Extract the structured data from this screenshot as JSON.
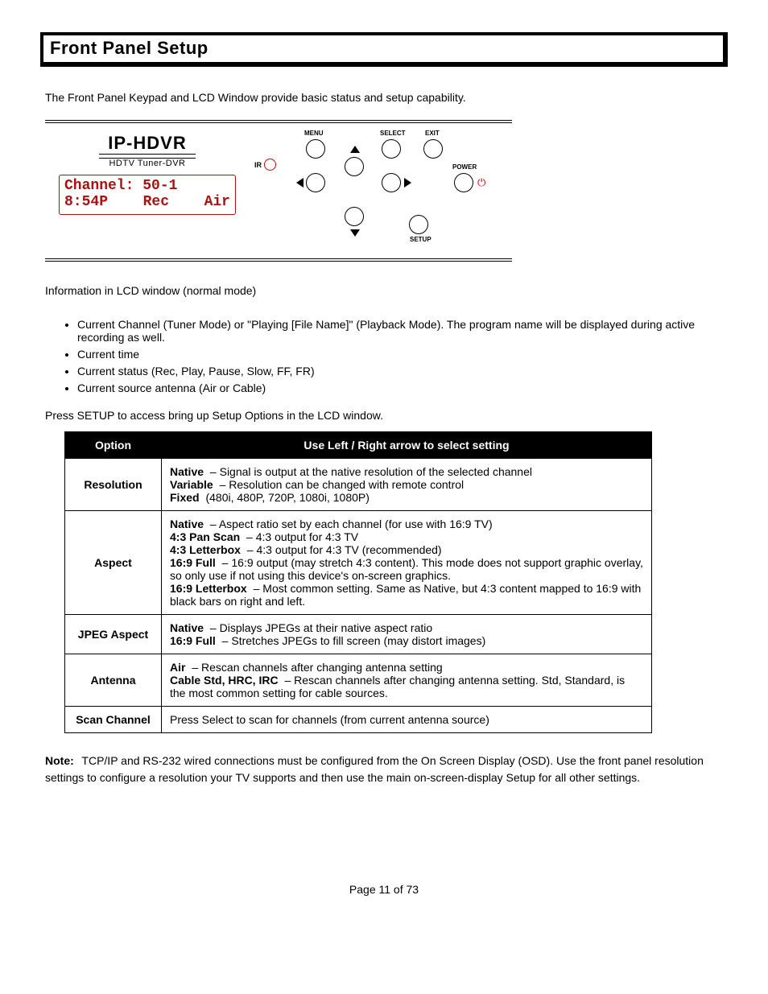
{
  "title": "Front Panel Setup",
  "intro": "The Front Panel Keypad and LCD Window provide basic status and setup capability.",
  "panel": {
    "brand": "IP-HDVR",
    "brandSub": "HDTV Tuner-DVR",
    "lcdLine1": "Channel: 50-1",
    "lcdTime": "8:54P",
    "lcdRec": "Rec",
    "lcdSrc": "Air",
    "irLabel": "IR",
    "labels": {
      "menu": "MENU",
      "select": "SELECT",
      "exit": "EXIT",
      "power": "POWER",
      "setup": "SETUP"
    }
  },
  "featuresLead": "Information in LCD window (normal mode)",
  "features": [
    "Current Channel (Tuner Mode) or \"Playing [File Name]\" (Playback Mode). The program name will be displayed during active recording as well.",
    "Current time",
    "Current status (Rec, Play, Pause, Slow, FF, FR)",
    "Current source antenna (Air or Cable)"
  ],
  "tableLead": "Press SETUP to access bring up Setup Options in the LCD window.",
  "table": {
    "headers": [
      "Option",
      "Use Left / Right arrow to select setting"
    ],
    "rows": [
      {
        "option": "Resolution",
        "settings": [
          [
            "Native",
            "Signal is output at the native resolution of the selected channel"
          ],
          [
            "Variable",
            "Resolution can be changed with remote control"
          ],
          [
            "Fixed",
            "(480i, 480P, 720P, 1080i, 1080P)"
          ]
        ]
      },
      {
        "option": "Aspect",
        "settings": [
          [
            "Native",
            "Aspect ratio set by each channel (for use with 16:9 TV)"
          ],
          [
            "4:3 Pan Scan",
            "4:3 output for 4:3 TV"
          ],
          [
            "4:3 Letterbox",
            "4:3 output for 4:3 TV (recommended)"
          ],
          [
            "16:9 Full",
            "16:9 output (may stretch 4:3 content). This mode does not support graphic overlay, so only use if not using this device's on-screen graphics."
          ],
          [
            "16:9 Letterbox",
            "Most common setting. Same as Native, but 4:3 content mapped to 16:9 with black bars on right and left."
          ]
        ]
      },
      {
        "option": "JPEG Aspect",
        "settings": [
          [
            "Native",
            "Displays JPEGs at their native aspect ratio"
          ],
          [
            "16:9 Full",
            "Stretches JPEGs to fill screen (may distort images)"
          ]
        ]
      },
      {
        "option": "Antenna",
        "settings": [
          [
            "Air",
            "Rescan channels after changing antenna setting"
          ],
          [
            "Cable Std, HRC, IRC",
            "Rescan channels after changing antenna setting. Std, Standard, is the most common setting for cable sources."
          ]
        ]
      },
      {
        "option": "Scan Channel",
        "settings": [
          [
            "",
            "Press Select to scan for channels (from current antenna source)"
          ]
        ]
      }
    ]
  },
  "noteLabel": "Note:",
  "note": "TCP/IP and RS-232 wired connections must be configured from the On Screen Display (OSD). Use the front panel resolution settings to configure a resolution your TV supports and then use the main on-screen-display Setup for all other settings.",
  "pageFooter": "Page 11 of 73"
}
